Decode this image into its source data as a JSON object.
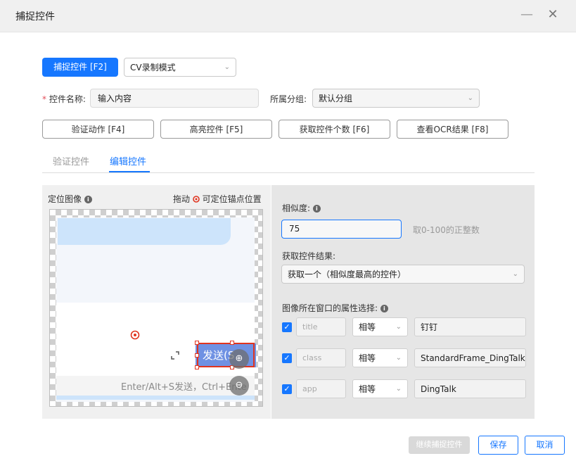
{
  "window": {
    "title": "捕捉控件",
    "minimize": "—",
    "close": "✕"
  },
  "toolbar": {
    "capture_label": "捕捉控件 [F2]",
    "mode_value": "CV录制模式"
  },
  "form": {
    "name_label": "控件名称:",
    "name_value": "输入内容",
    "group_label": "所属分组:",
    "group_value": "默认分组"
  },
  "actions": {
    "verify": "验证动作 [F4]",
    "highlight": "高亮控件 [F5]",
    "count": "获取控件个数 [F6]",
    "ocr": "查看OCR结果 [F8]"
  },
  "tabs": [
    {
      "label": "验证控件",
      "active": false
    },
    {
      "label": "编辑控件",
      "active": true
    }
  ],
  "locator": {
    "title": "定位图像",
    "hint_prefix": "拖动",
    "hint_suffix": "可定位锚点位置",
    "preview_send": "发送(S",
    "preview_input": "Enter/Alt+S发送，Ctrl+Ente"
  },
  "similarity": {
    "label": "相似度:",
    "value": "75",
    "hint": "取0-100的正整数"
  },
  "result": {
    "label": "获取控件结果:",
    "value": "获取一个（相似度最高的控件）"
  },
  "attributes": {
    "label": "图像所在窗口的属性选择:",
    "rows": [
      {
        "checked": true,
        "name": "title",
        "op": "相等",
        "value": "钉钉"
      },
      {
        "checked": true,
        "name": "class",
        "op": "相等",
        "value": "StandardFrame_DingTalk"
      },
      {
        "checked": true,
        "name": "app",
        "op": "相等",
        "value": "DingTalk"
      }
    ]
  },
  "footer": {
    "continue": "继续捕捉控件",
    "save": "保存",
    "cancel": "取消"
  },
  "colors": {
    "accent": "#1677ff",
    "required": "#e34d59",
    "anchor": "#e0341f"
  }
}
